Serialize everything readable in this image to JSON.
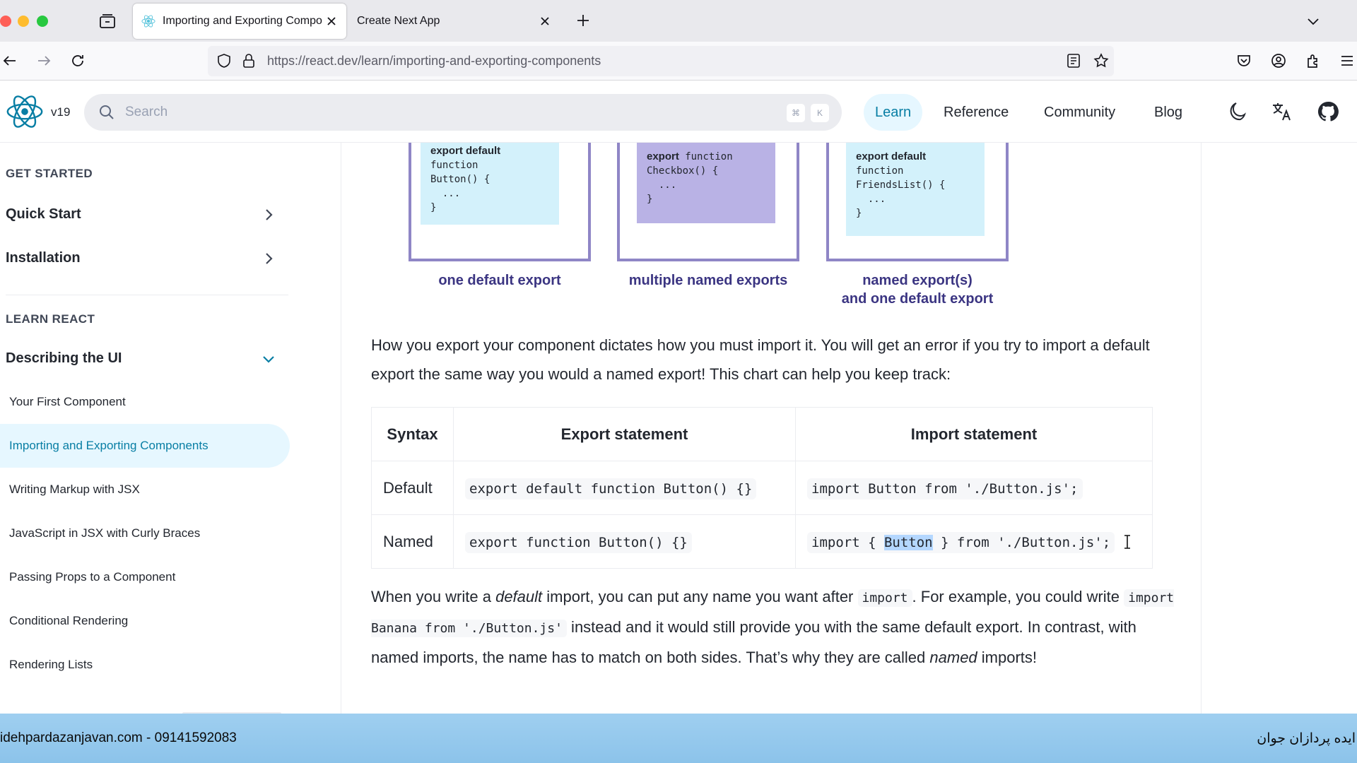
{
  "browser": {
    "tabs": [
      {
        "title": "Importing and Exporting Compo",
        "active": true
      },
      {
        "title": "Create Next App",
        "active": false
      }
    ],
    "url": {
      "host": "https://react.dev",
      "path": "/learn/importing-and-exporting-components"
    }
  },
  "header": {
    "version": "v19",
    "search_placeholder": "Search",
    "kbd_cmd": "⌘",
    "kbd_k": "K",
    "nav": {
      "learn": "Learn",
      "reference": "Reference",
      "community": "Community",
      "blog": "Blog"
    },
    "accent": "#087ea4"
  },
  "sidebar": {
    "section_get_started": "GET STARTED",
    "quick_start": "Quick Start",
    "installation": "Installation",
    "section_learn_react": "LEARN REACT",
    "describing_ui": "Describing the UI",
    "sub_items": [
      "Your First Component",
      "Importing and Exporting Components",
      "Writing Markup with JSX",
      "JavaScript in JSX with Curly Braces",
      "Passing Props to a Component",
      "Conditional Rendering",
      "Rendering Lists"
    ],
    "active_index": 1
  },
  "diagram": {
    "default_card": {
      "line1": "export default",
      "line2": "function",
      "line3": "Button() {",
      "line4": "  ...",
      "line5": "}"
    },
    "named_card": {
      "kw": "export",
      "fn": "function",
      "line2": "Checkbox() {",
      "line3": "  ...",
      "line4": "}"
    },
    "mixed_card": {
      "line1": "export default",
      "line2": "function",
      "line3": "FriendsList() {",
      "line4": "  ...",
      "line5": "}"
    },
    "label_default": "one default export",
    "label_named": "multiple named exports",
    "label_mixed_1": "named export(s)",
    "label_mixed_2": "and one default export"
  },
  "content": {
    "para1": "How you export your component dictates how you must import it. You will get an error if you try to import a default export the same way you would a named export! This chart can help you keep track:",
    "table": {
      "headers": [
        "Syntax",
        "Export statement",
        "Import statement"
      ],
      "rows": [
        {
          "syntax": "Default",
          "export": "export default function Button() {}",
          "import": "import Button from './Button.js';"
        },
        {
          "syntax": "Named",
          "export": "export function Button() {}",
          "import_pre": "import { ",
          "import_sel": "Button",
          "import_post": " } from './Button.js';"
        }
      ]
    },
    "para2": {
      "t1": "When you write a ",
      "em1": "default",
      "t2": " import, you can put any name you want after ",
      "code1": "import",
      "t3": ". For example, you could write ",
      "code2": "import Banana from './Button.js'",
      "t4": " instead and it would still provide you with the same default export. In contrast, with named imports, the name has to match on both sides. That’s why they are called ",
      "em2": "named",
      "t5": " imports!"
    }
  },
  "banner": {
    "left": "idehpardazanjavan.com - 09141592083",
    "right": "ایده پردازان جوان"
  }
}
